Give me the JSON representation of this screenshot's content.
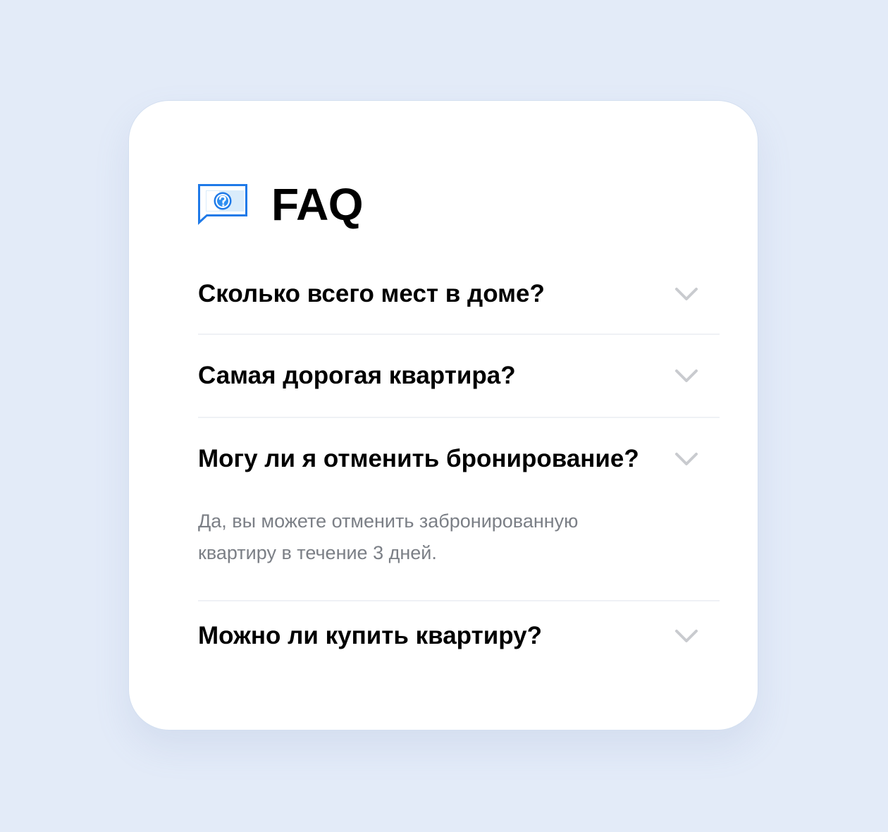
{
  "faq": {
    "title": "FAQ",
    "icon": "question-chat-bubble-icon",
    "accent_color": "#1f7ae8",
    "items": [
      {
        "question": "Сколько всего мест в доме?",
        "expanded": false,
        "icon": "chevron-down-icon"
      },
      {
        "question": "Самая дорогая квартира?",
        "expanded": false,
        "icon": "chevron-down-icon"
      },
      {
        "question": "Могу ли я отменить бронирование?",
        "expanded": true,
        "answer": "Да, вы можете отменить забронированную квартиру в течение 3 дней.",
        "icon": "chevron-down-icon"
      },
      {
        "question": "Можно ли купить квартиру?",
        "expanded": false,
        "icon": "chevron-down-icon"
      }
    ]
  }
}
